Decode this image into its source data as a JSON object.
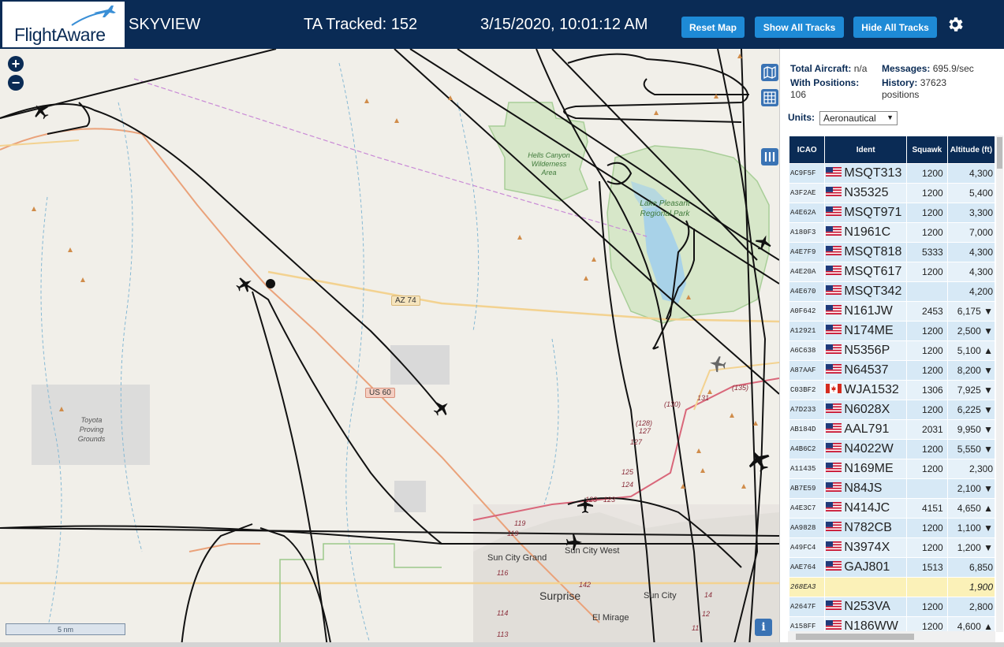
{
  "header": {
    "logo_text": "FlightAware",
    "site_name": "SKYVIEW",
    "tracked": "TA Tracked: 152",
    "clock": "3/15/2020, 10:01:12 AM",
    "buttons": {
      "reset": "Reset Map",
      "show_all": "Show All Tracks",
      "hide_all": "Hide All Tracks"
    },
    "colors": {
      "header_bg": "#0a2b55",
      "button_bg": "#1e8ad6"
    }
  },
  "map": {
    "zoom_in": "+",
    "zoom_out": "−",
    "scale": "5 nm",
    "info": "i",
    "labels": {
      "hells_canyon": "Hells Canyon Wilderness Area",
      "lake_pleasant": "Lake Pleasant Regional Park",
      "toyota": "Toyota Proving Grounds",
      "az74": "AZ 74",
      "us60": "US 60",
      "sun_city_grand": "Sun City Grand",
      "sun_city_west": "Sun City West",
      "surprise": "Surprise",
      "sun_city": "Sun City",
      "el_mirage": "El Mirage",
      "r135": "(135)",
      "r131": "131",
      "r130": "(130)",
      "r128": "(128)",
      "r127a": "127",
      "r127b": "127",
      "r125": "125",
      "r124": "124",
      "r123a": "123",
      "r123b": "123",
      "r119a": "119",
      "r119b": "119",
      "r116": "116",
      "r114": "114",
      "r113": "113",
      "r142": "142",
      "r14": "14",
      "r12": "12",
      "r11": "11"
    }
  },
  "sidebar": {
    "total_aircraft_label": "Total Aircraft:",
    "total_aircraft": "n/a",
    "messages_label": "Messages:",
    "messages": "695.9/sec",
    "with_positions_label": "With Positions:",
    "with_positions": "106",
    "history_label": "History:",
    "history": "37623",
    "history_unit": "positions",
    "units_label": "Units:",
    "units_value": "Aeronautical",
    "columns": {
      "icao": "ICAO",
      "ident": "Ident",
      "squawk": "Squawk",
      "altitude": "Altitude (ft)"
    },
    "rows": [
      {
        "icao": "AC9F5F",
        "flag": "us",
        "ident": "MSQT313",
        "squawk": "1200",
        "alt": "4,300"
      },
      {
        "icao": "A3F2AE",
        "flag": "us",
        "ident": "N35325",
        "squawk": "1200",
        "alt": "5,400"
      },
      {
        "icao": "A4E62A",
        "flag": "us",
        "ident": "MSQT971",
        "squawk": "1200",
        "alt": "3,300"
      },
      {
        "icao": "A180F3",
        "flag": "us",
        "ident": "N1961C",
        "squawk": "1200",
        "alt": "7,000"
      },
      {
        "icao": "A4E7F9",
        "flag": "us",
        "ident": "MSQT818",
        "squawk": "5333",
        "alt": "4,300"
      },
      {
        "icao": "A4E20A",
        "flag": "us",
        "ident": "MSQT617",
        "squawk": "1200",
        "alt": "4,300"
      },
      {
        "icao": "A4E670",
        "flag": "us",
        "ident": "MSQT342",
        "squawk": "",
        "alt": "4,200"
      },
      {
        "icao": "A0F642",
        "flag": "us",
        "ident": "N161JW",
        "squawk": "2453",
        "alt": "6,175 ▼"
      },
      {
        "icao": "A12921",
        "flag": "us",
        "ident": "N174ME",
        "squawk": "1200",
        "alt": "2,500 ▼"
      },
      {
        "icao": "A6C638",
        "flag": "us",
        "ident": "N5356P",
        "squawk": "1200",
        "alt": "5,100 ▲"
      },
      {
        "icao": "A87AAF",
        "flag": "us",
        "ident": "N64537",
        "squawk": "1200",
        "alt": "8,200 ▼"
      },
      {
        "icao": "C03BF2",
        "flag": "ca",
        "ident": "WJA1532",
        "squawk": "1306",
        "alt": "7,925 ▼"
      },
      {
        "icao": "A7D233",
        "flag": "us",
        "ident": "N6028X",
        "squawk": "1200",
        "alt": "6,225 ▼"
      },
      {
        "icao": "AB184D",
        "flag": "us",
        "ident": "AAL791",
        "squawk": "2031",
        "alt": "9,950 ▼"
      },
      {
        "icao": "A4B6C2",
        "flag": "us",
        "ident": "N4022W",
        "squawk": "1200",
        "alt": "5,550 ▼"
      },
      {
        "icao": "A11435",
        "flag": "us",
        "ident": "N169ME",
        "squawk": "1200",
        "alt": "2,300"
      },
      {
        "icao": "AB7E59",
        "flag": "us",
        "ident": "N84JS",
        "squawk": "",
        "alt": "2,100 ▼"
      },
      {
        "icao": "A4E3C7",
        "flag": "us",
        "ident": "N414JC",
        "squawk": "4151",
        "alt": "4,650 ▲"
      },
      {
        "icao": "AA9828",
        "flag": "us",
        "ident": "N782CB",
        "squawk": "1200",
        "alt": "1,100 ▼"
      },
      {
        "icao": "A49FC4",
        "flag": "us",
        "ident": "N3974X",
        "squawk": "1200",
        "alt": "1,200 ▼"
      },
      {
        "icao": "AAE764",
        "flag": "us",
        "ident": "GAJ801",
        "squawk": "1513",
        "alt": "6,850"
      },
      {
        "icao": "268EA3",
        "flag": "",
        "ident": "",
        "squawk": "",
        "alt": "1,900",
        "selected": true
      },
      {
        "icao": "A2647F",
        "flag": "us",
        "ident": "N253VA",
        "squawk": "1200",
        "alt": "2,800"
      },
      {
        "icao": "A158FF",
        "flag": "us",
        "ident": "N186WW",
        "squawk": "1200",
        "alt": "4,600 ▲"
      }
    ]
  }
}
